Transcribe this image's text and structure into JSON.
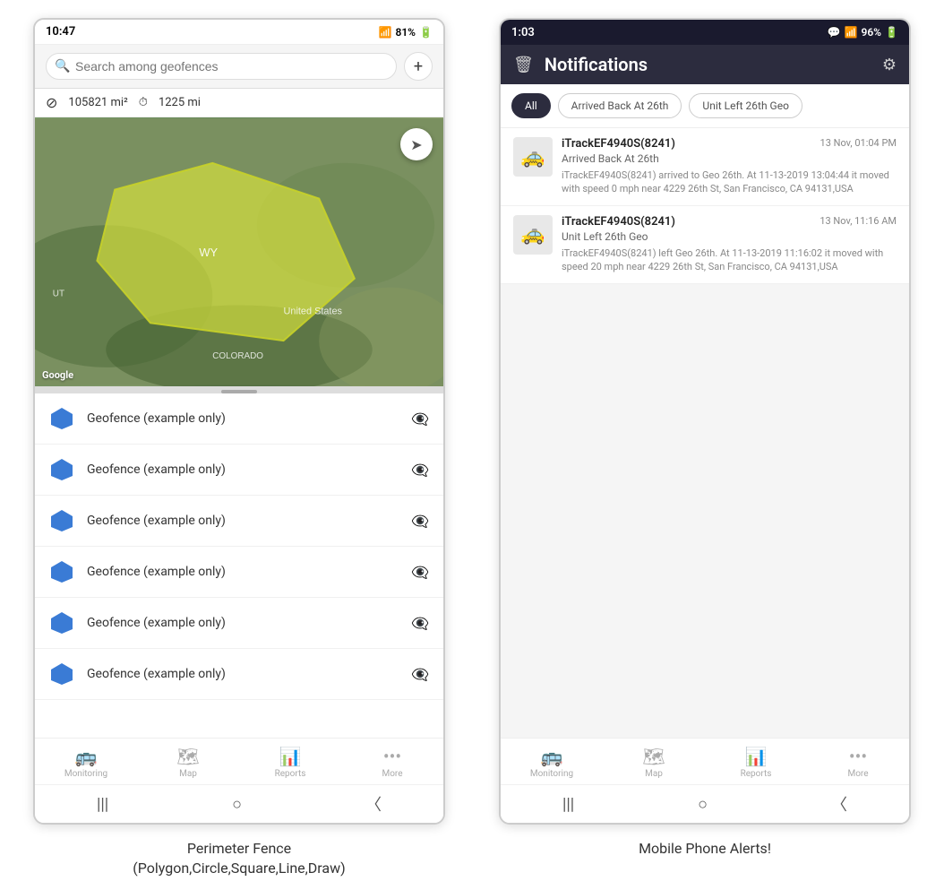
{
  "left_phone": {
    "status_bar": {
      "time": "10:47",
      "wifi": "WiFi",
      "signal": "81%"
    },
    "search": {
      "placeholder": "Search among geofences"
    },
    "stats": {
      "area": "105821 mi²",
      "distance": "1225 mi"
    },
    "map": {
      "label_wy": "WY",
      "label_us": "United States",
      "label_colorado": "COLORADO",
      "label_ut": "UT"
    },
    "geofences": [
      {
        "name": "Geofence (example only)"
      },
      {
        "name": "Geofence (example only)"
      },
      {
        "name": "Geofence (example only)"
      },
      {
        "name": "Geofence (example only)"
      },
      {
        "name": "Geofence (example only)"
      },
      {
        "name": "Geofence (example only)"
      }
    ],
    "bottom_nav": [
      {
        "label": "Monitoring",
        "icon": "🚌"
      },
      {
        "label": "Map",
        "icon": "🗺"
      },
      {
        "label": "Reports",
        "icon": "📊"
      },
      {
        "label": "More",
        "icon": "···"
      }
    ],
    "caption": "Perimeter Fence\n(Polygon,Circle,Square,Line,Draw)"
  },
  "right_phone": {
    "status_bar": {
      "time": "1:03",
      "signal": "96%"
    },
    "header": {
      "title": "Notifications"
    },
    "filters": [
      {
        "label": "All",
        "active": true
      },
      {
        "label": "Arrived Back At 26th",
        "active": false
      },
      {
        "label": "Unit Left 26th Geo",
        "active": false
      }
    ],
    "notifications": [
      {
        "device": "iTrackEF4940S(8241)",
        "time": "13 Nov, 01:04 PM",
        "subtitle": "Arrived Back At 26th",
        "body": "iTrackEF4940S(8241) arrived to Geo 26th.   At 11-13-2019 13:04:44 it moved with speed 0 mph near 4229 26th St, San Francisco, CA 94131,USA",
        "car_color": "#f5c518"
      },
      {
        "device": "iTrackEF4940S(8241)",
        "time": "13 Nov, 11:16 AM",
        "subtitle": "Unit Left 26th Geo",
        "body": "iTrackEF4940S(8241) left Geo 26th.   At 11-13-2019 11:16:02 it moved with speed 20 mph near 4229 26th St, San Francisco, CA 94131,USA",
        "car_color": "#f5c518"
      }
    ],
    "bottom_nav": [
      {
        "label": "Monitoring",
        "icon": "🚌"
      },
      {
        "label": "Map",
        "icon": "🗺"
      },
      {
        "label": "Reports",
        "icon": "📊"
      },
      {
        "label": "More",
        "icon": "···"
      }
    ],
    "caption": "Mobile Phone Alerts!"
  }
}
